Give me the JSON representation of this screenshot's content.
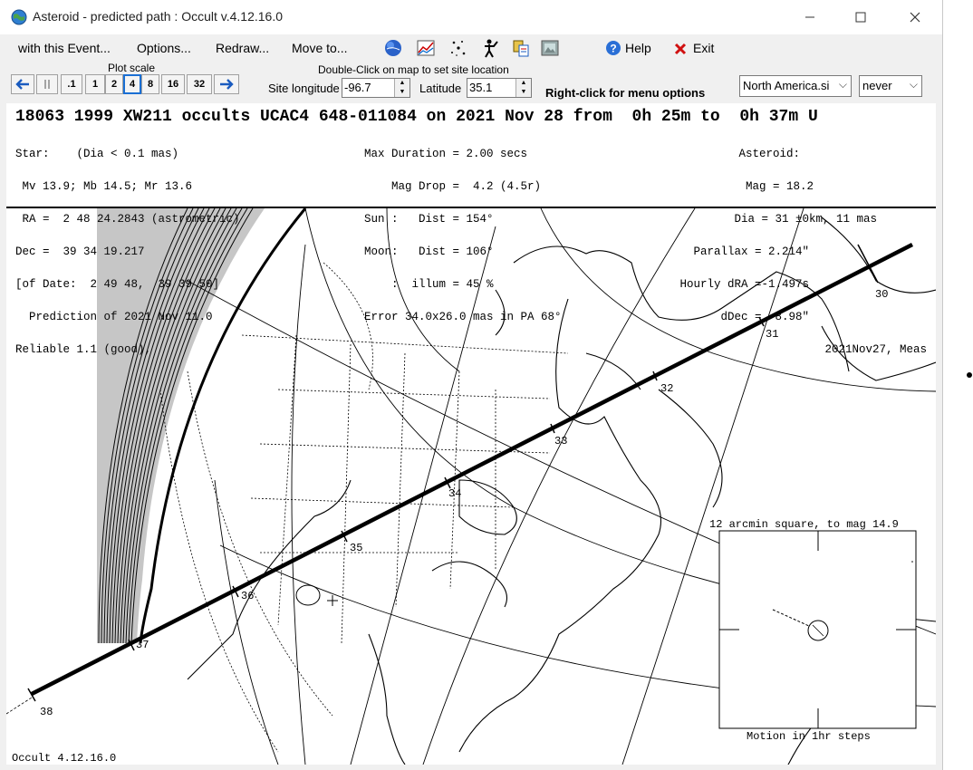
{
  "window": {
    "title": "Asteroid - predicted path : Occult v.4.12.16.0"
  },
  "menu": {
    "event": "with this Event...",
    "options": "Options...",
    "redraw": "Redraw...",
    "moveto": "Move to...",
    "help": "Help",
    "exit": "Exit"
  },
  "plot_scale": {
    "label": "Plot scale",
    "buttons": [
      ".1",
      "1",
      "2",
      "4",
      "8",
      "16",
      "32"
    ],
    "selected": "4"
  },
  "site": {
    "hint": "Double-Click on map to set site location",
    "lon_label": "Site longitude",
    "lon_value": "-96.7",
    "lat_label": "Latitude",
    "lat_value": "35.1",
    "rightclick_hint": "Right-click for menu options",
    "sites_file": "North America.si",
    "update": "never"
  },
  "header": {
    "title": "18063 1999 XW211 occults UCAC4 648-011084 on 2021 Nov 28 from  0h 25m to  0h 37m U",
    "left": [
      "Star:    (Dia < 0.1 mas)",
      " Mv 13.9; Mb 14.5; Mr 13.6",
      " RA =  2 48 24.2843 (astrometric)",
      "Dec =  39 34 19.217",
      "[of Date:  2 49 48,  39 39 50]",
      "  Prediction of 2021 Nov 11.0",
      "Reliable 1.1 (good),"
    ],
    "mid": [
      "Max Duration = 2.00 secs",
      "    Mag Drop =  4.2 (4.5r)",
      "Sun :   Dist = 154°",
      "Moon:   Dist = 106°",
      "    :  illum = 45 %",
      "Error 34.0x26.0 mas in PA 68°"
    ],
    "right": [
      "Asteroid:",
      "     Mag = 18.2",
      "     Dia = 31 ±0km, 11 mas",
      "Parallax = 2.214\"",
      "Hourly dRA =-1.497s",
      "dDec = -8.98\"",
      "2021Nov27, Meas"
    ]
  },
  "map": {
    "time_labels": [
      "30",
      "31",
      "32",
      "33",
      "34",
      "35",
      "36",
      "37",
      "38"
    ],
    "inset_title": "12 arcmin square, to mag 14.9",
    "inset_caption": "Motion in 1hr steps",
    "footer": "Occult 4.12.16.0"
  }
}
